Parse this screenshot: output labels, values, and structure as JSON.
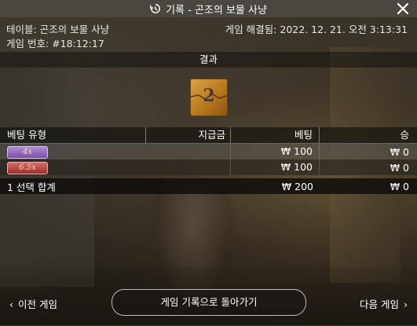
{
  "window": {
    "title": "기록 - 곤조의 보물 사냥",
    "history_icon": "history-icon",
    "close_icon": "close-icon"
  },
  "meta": {
    "table": "테이블: 곤조의 보물 사냥",
    "round": "게임 번호: #18:12:17",
    "settled": "게임 해결됨: 2022. 12. 21. 오전 3:13:31"
  },
  "result": {
    "header": "결과",
    "tile_value": "2",
    "tile_color": "#c98a2a"
  },
  "bets": {
    "columns": [
      "베팅 유형",
      "지급금",
      "베팅",
      "승"
    ],
    "rows": [
      {
        "type": "4x",
        "type_color": "#8e63b8",
        "payout": "",
        "bet": "₩ 100",
        "win": "₩ 0"
      },
      {
        "type": "6.5x",
        "type_color": "#b44444",
        "payout": "",
        "bet": "₩ 100",
        "win": "₩ 0"
      }
    ],
    "total": {
      "label": "1 선택 합계",
      "payout": "",
      "bet": "₩ 200",
      "win": "₩ 0"
    }
  },
  "footer": {
    "prev": "이전 게임",
    "back": "게임 기록으로 돌아가기",
    "next": "다음 게임"
  }
}
